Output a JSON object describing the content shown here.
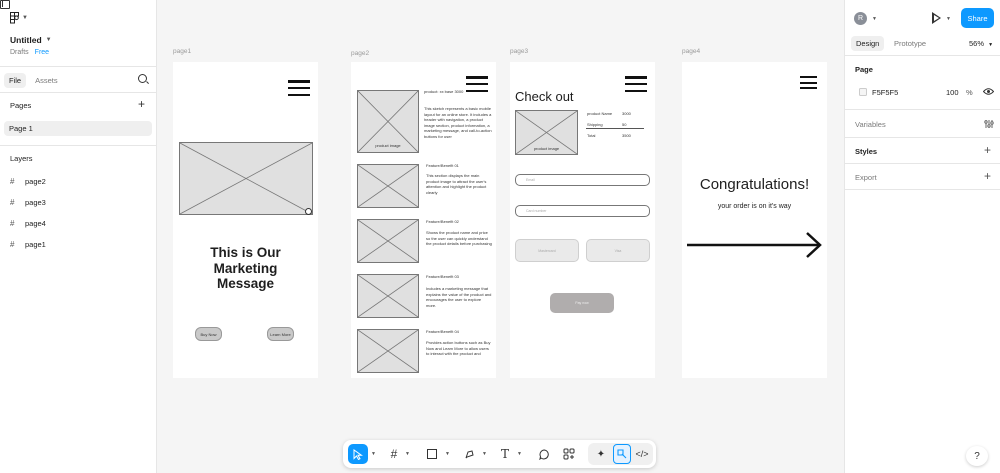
{
  "left_panel": {
    "file_name": "Untitled",
    "location": "Drafts",
    "plan": "Free",
    "tabs": [
      "File",
      "Assets"
    ],
    "pages_title": "Pages",
    "current_page": "Page 1",
    "layers_title": "Layers",
    "layers": [
      "page2",
      "page3",
      "page4",
      "page1"
    ]
  },
  "canvas": {
    "frame_labels": [
      "page1",
      "page2",
      "page3",
      "page4"
    ],
    "page1": {
      "message": "This is Our Marketing Message",
      "buttons": [
        "Buy Now",
        "Learn More"
      ]
    },
    "page2": {
      "product_image_caption": "product image",
      "intro_heading": "product: xx base 3000",
      "intro_text": "This sketch represents a basic mobile layout for an online store. It includes a header with navigation, a product image section, product information, a marketing message, and call-to-action buttons for user",
      "features": [
        {
          "title": "Feature/Benefit 01",
          "text": "This section displays the main product image to attract the user's attention and highlight the product clearly"
        },
        {
          "title": "Feature/Benefit 02",
          "text": "Shows the product name and price so the user can quickly understand the product details before purchasing"
        },
        {
          "title": "Feature/Benefit 03",
          "text": "Includes a marketing message that explains the value of the product and encourages the user to explore more."
        },
        {
          "title": "Feature/Benefit 04",
          "text": "Provides action buttons such as Buy Now and Learn More to allow users to interact with the product and"
        }
      ]
    },
    "page3": {
      "title": "Check out",
      "product_image_caption": "product image",
      "summary": [
        {
          "label": "product Name",
          "value": "3000"
        },
        {
          "label": "Shipping",
          "value": "50"
        },
        {
          "label": "Total",
          "value": "3500"
        }
      ],
      "inputs": [
        "Email",
        "Card number"
      ],
      "options": [
        "Mastercard",
        "Visa"
      ],
      "pay_button": "Pay now"
    },
    "page4": {
      "title": "Congratulations!",
      "subtitle": "your order is on it's way"
    }
  },
  "right_panel": {
    "avatar_initial": "R",
    "share_label": "Share",
    "tabs": [
      "Design",
      "Prototype"
    ],
    "zoom": "56%",
    "page_title": "Page",
    "bg_color": "F5F5F5",
    "bg_opacity": "100",
    "opacity_unit": "%",
    "sections": [
      "Variables",
      "Styles",
      "Export"
    ],
    "help": "?"
  },
  "colors": {
    "accent": "#0d99ff",
    "canvas_bg": "#f5f5f5"
  }
}
